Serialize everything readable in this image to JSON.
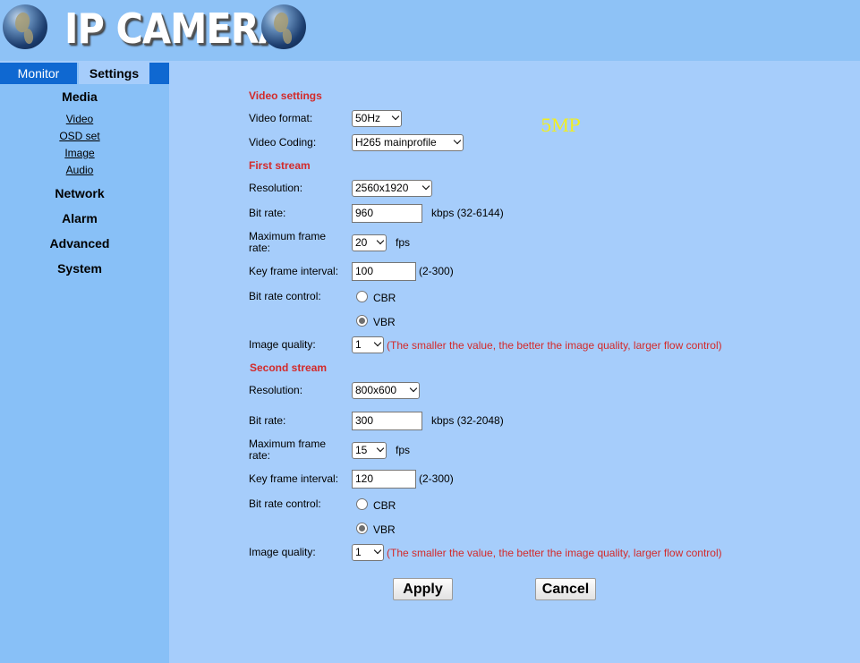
{
  "header": {
    "title": "IP CAMERA"
  },
  "tabs": {
    "monitor": "Monitor",
    "settings": "Settings"
  },
  "sidebar": {
    "media": "Media",
    "media_items": [
      "Video",
      "OSD set",
      "Image",
      "Audio"
    ],
    "network": "Network",
    "alarm": "Alarm",
    "advanced": "Advanced",
    "system": "System"
  },
  "badge": "5MP",
  "video": {
    "section": "Video settings",
    "format_label": "Video format:",
    "format_value": "50Hz",
    "coding_label": "Video Coding:",
    "coding_value": "H265 mainprofile"
  },
  "first_stream": {
    "section": "First stream",
    "resolution_label": "Resolution:",
    "resolution_value": "2560x1920",
    "bitrate_label": "Bit rate:",
    "bitrate_value": "960",
    "bitrate_hint": "kbps (32-6144)",
    "framerate_label": "Maximum frame rate:",
    "framerate_value": "20",
    "framerate_unit": "fps",
    "keyframe_label": "Key frame interval:",
    "keyframe_value": "100",
    "keyframe_hint": "(2-300)",
    "control_label": "Bit rate control:",
    "cbr": "CBR",
    "vbr": "VBR",
    "control_selected": "VBR",
    "quality_label": "Image quality:",
    "quality_value": "1",
    "quality_hint": "(The smaller the value, the better the image quality, larger flow control)"
  },
  "second_stream": {
    "section": "Second stream",
    "resolution_label": "Resolution:",
    "resolution_value": "800x600",
    "bitrate_label": "Bit rate:",
    "bitrate_value": "300",
    "bitrate_hint": "kbps (32-2048)",
    "framerate_label": "Maximum frame rate:",
    "framerate_value": "15",
    "framerate_unit": "fps",
    "keyframe_label": "Key frame interval:",
    "keyframe_value": "120",
    "keyframe_hint": "(2-300)",
    "control_label": "Bit rate control:",
    "cbr": "CBR",
    "vbr": "VBR",
    "control_selected": "VBR",
    "quality_label": "Image quality:",
    "quality_value": "1",
    "quality_hint": "(The smaller the value, the better the image quality, larger flow control)"
  },
  "buttons": {
    "apply": "Apply",
    "cancel": "Cancel"
  }
}
